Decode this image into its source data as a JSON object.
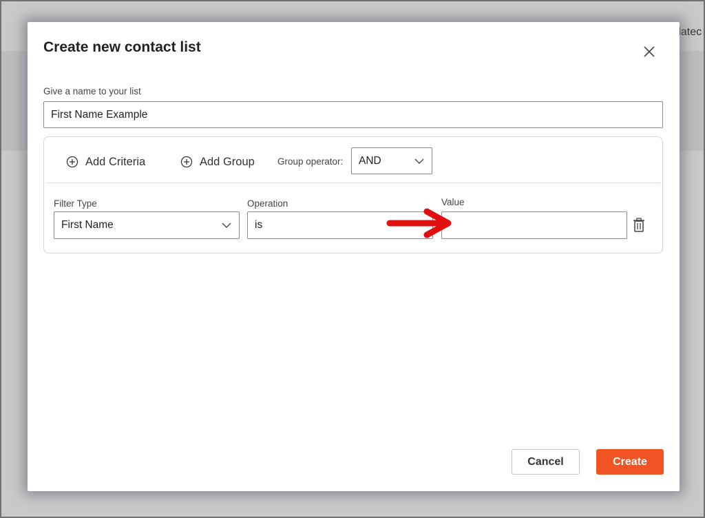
{
  "background": {
    "partial_text": "datec"
  },
  "dialog": {
    "title": "Create new contact list",
    "close_icon": "close-icon",
    "list_name": {
      "label": "Give a name to your list",
      "value": "First Name Example"
    },
    "criteria": {
      "add_criteria_label": "Add Criteria",
      "add_group_label": "Add Group",
      "group_operator_label": "Group operator:",
      "group_operator_value": "AND",
      "row": {
        "filter_type_label": "Filter Type",
        "filter_type_value": "First Name",
        "operation_label": "Operation",
        "operation_value": "is",
        "value_label": "Value",
        "value_value": ""
      }
    },
    "buttons": {
      "cancel": "Cancel",
      "create": "Create"
    }
  },
  "colors": {
    "accent": "#f05423",
    "annotation_arrow": "#e01010",
    "border": "#8a8a8a"
  }
}
